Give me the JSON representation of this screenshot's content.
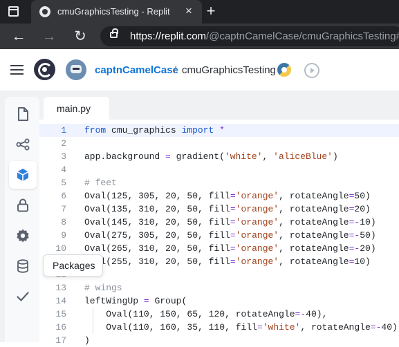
{
  "browser": {
    "tab_title": "cmuGraphicsTesting - Replit",
    "url_host": "https://replit.com",
    "url_path": "/@captnCamelCase/cmuGraphicsTesting#mai",
    "icons": [
      "window-icon",
      "replit-favicon-icon",
      "close-icon",
      "plus-icon",
      "back-arrow-icon",
      "forward-arrow-icon",
      "reload-icon",
      "lock-icon"
    ]
  },
  "header": {
    "owner": "captnCamelCase",
    "separator": "/",
    "repl_name": "cmuGraphicsTesting",
    "icons": [
      "hamburger-icon",
      "replit-logo",
      "avatar",
      "python-icon",
      "history-icon"
    ]
  },
  "sidebar": {
    "items": [
      {
        "name": "files",
        "icon": "file-icon",
        "active": false
      },
      {
        "name": "share",
        "icon": "share-icon",
        "active": false
      },
      {
        "name": "packages",
        "icon": "cube-icon",
        "active": true
      },
      {
        "name": "secrets",
        "icon": "lock-icon",
        "active": false
      },
      {
        "name": "settings",
        "icon": "gear-icon",
        "active": false
      },
      {
        "name": "database",
        "icon": "database-icon",
        "active": false
      },
      {
        "name": "unit-tests",
        "icon": "check-icon",
        "active": false
      }
    ]
  },
  "tooltip": {
    "label": "Packages"
  },
  "editor": {
    "file_tab": "main.py",
    "current_line": 1,
    "lines": [
      {
        "n": "1",
        "text": "from cmu_graphics import *"
      },
      {
        "n": "2",
        "text": ""
      },
      {
        "n": "3",
        "text": "app.background = gradient('white', 'aliceBlue')"
      },
      {
        "n": "4",
        "text": ""
      },
      {
        "n": "5",
        "text": "# feet"
      },
      {
        "n": "6",
        "text": "Oval(125, 305, 20, 50, fill='orange', rotateAngle=50)"
      },
      {
        "n": "7",
        "text": "Oval(135, 310, 20, 50, fill='orange', rotateAngle=20)"
      },
      {
        "n": "8",
        "text": "Oval(145, 310, 20, 50, fill='orange', rotateAngle=-10)"
      },
      {
        "n": "9",
        "text": "Oval(275, 305, 20, 50, fill='orange', rotateAngle=-50)"
      },
      {
        "n": "10",
        "text": "Oval(265, 310, 20, 50, fill='orange', rotateAngle=-20)"
      },
      {
        "n": "11",
        "text": "Oval(255, 310, 20, 50, fill='orange', rotateAngle=10)"
      },
      {
        "n": "12",
        "text": ""
      },
      {
        "n": "13",
        "text": "# wings"
      },
      {
        "n": "14",
        "text": "leftWingUp = Group("
      },
      {
        "n": "15",
        "text": "    Oval(110, 150, 65, 120, rotateAngle=-40),"
      },
      {
        "n": "16",
        "text": "    Oval(110, 160, 35, 110, fill='white', rotateAngle=-40)"
      },
      {
        "n": "17",
        "text": ")"
      }
    ]
  },
  "colors": {
    "keyword": "#1a56c9",
    "string": "#a1411d",
    "comment": "#8a919a",
    "operator": "#7c2fd1",
    "link": "#0f76d8"
  }
}
